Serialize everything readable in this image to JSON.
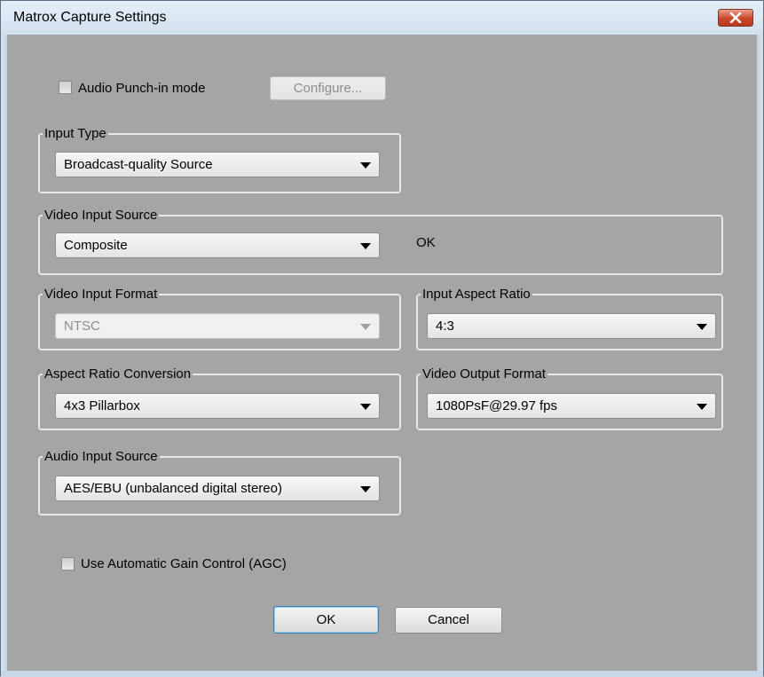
{
  "window": {
    "title": "Matrox Capture Settings"
  },
  "punch_in": {
    "label": "Audio Punch-in mode",
    "checked": false,
    "configure_label": "Configure..."
  },
  "input_type": {
    "legend": "Input Type",
    "value": "Broadcast-quality Source"
  },
  "video_input_source": {
    "legend": "Video Input Source",
    "value": "Composite",
    "status": "OK"
  },
  "video_input_format": {
    "legend": "Video Input Format",
    "value": "NTSC",
    "enabled": false
  },
  "input_aspect_ratio": {
    "legend": "Input Aspect Ratio",
    "value": "4:3"
  },
  "aspect_ratio_conversion": {
    "legend": "Aspect Ratio Conversion",
    "value": "4x3 Pillarbox"
  },
  "video_output_format": {
    "legend": "Video Output Format",
    "value": "1080PsF@29.97 fps"
  },
  "audio_input_source": {
    "legend": "Audio Input Source",
    "value": "AES/EBU (unbalanced digital stereo)"
  },
  "agc": {
    "label": "Use Automatic Gain Control (AGC)",
    "checked": false
  },
  "buttons": {
    "ok": "OK",
    "cancel": "Cancel"
  },
  "colors": {
    "dialog_bg": "#a5a5a5",
    "titlebar": "#dbe7f3",
    "close_button": "#c9462a",
    "group_border": "#e8e8e8"
  }
}
